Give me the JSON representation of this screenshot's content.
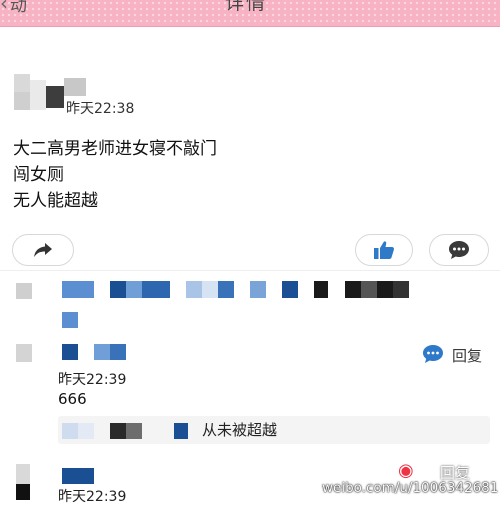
{
  "nav": {
    "back_label": "动",
    "title": "详情"
  },
  "post": {
    "time": "昨天22:38",
    "lines": [
      "大二高男老师进女寝不敲门",
      "闯女厕",
      "无人能超越"
    ]
  },
  "actions": {
    "share_icon": "share-arrow-icon",
    "like_icon": "thumbs-up-icon",
    "comment_icon": "comment-bubble-icon"
  },
  "comments": [
    {
      "time": "昨天22:39",
      "text": "666",
      "reply_label": "回复",
      "sub_reply": {
        "text": "从未被超越"
      }
    },
    {
      "time": "昨天22:39"
    }
  ],
  "watermark": {
    "text": "weibo.com/u/1006342681",
    "overlay_label": "回复"
  },
  "colors": {
    "nav_bg": "#f7b3c4",
    "accent_blue": "#2f79c9"
  }
}
